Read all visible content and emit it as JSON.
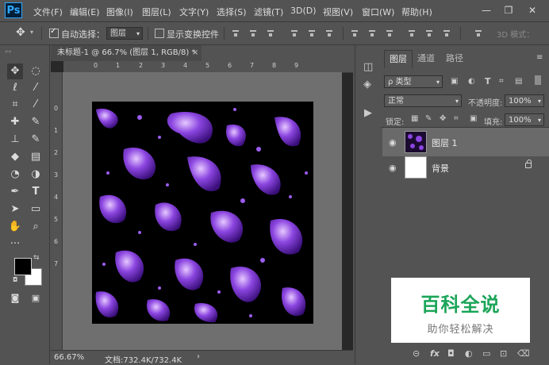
{
  "app": {
    "logo": "Ps"
  },
  "menu": [
    "文件(F)",
    "编辑(E)",
    "图像(I)",
    "图层(L)",
    "文字(Y)",
    "选择(S)",
    "滤镜(T)",
    "3D(D)",
    "视图(V)",
    "窗口(W)",
    "帮助(H)"
  ],
  "options": {
    "auto_select_label": "自动选择：",
    "auto_select_value": "图层",
    "show_transform_label": "显示变换控件",
    "mode_3d_label": "3D 模式："
  },
  "document": {
    "tab_title": "未标题-1 @ 66.7% (图层 1, RGB/8) *",
    "zoom": "66.67%",
    "doc_info": "文档:732.4K/732.4K",
    "ruler_top_labels": [
      "0",
      "1",
      "2",
      "3",
      "4",
      "5",
      "6",
      "7",
      "8",
      "9"
    ],
    "ruler_left_labels": [
      "0",
      "1",
      "2",
      "3",
      "4",
      "5",
      "6",
      "7"
    ]
  },
  "layers_panel": {
    "tabs": [
      "图层",
      "通道",
      "路径"
    ],
    "filter_label": "ρ 类型",
    "blend_mode": "正常",
    "opacity_label": "不透明度:",
    "opacity_value": "100%",
    "lock_label": "锁定:",
    "fill_label": "填充:",
    "fill_value": "100%",
    "layers": [
      {
        "name": "图层 1",
        "selected": true
      },
      {
        "name": "背景",
        "selected": false,
        "locked": true
      }
    ]
  },
  "watermark": {
    "title": "百科全说",
    "subtitle": "助你轻松解决"
  },
  "colors": {
    "foreground": "#000000",
    "background": "#ffffff",
    "art": "#7b3fd6"
  }
}
